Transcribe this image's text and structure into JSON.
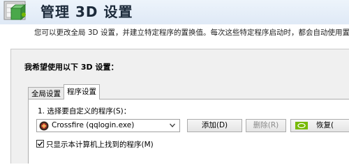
{
  "header": {
    "title": "管理 3D 设置",
    "description": "您可以更改全局 3D 设置，并建立特定程序的置换值。每次这些特定程序启动时，都会自动使用置换"
  },
  "panel": {
    "title": "我希望使用以下 3D 设置："
  },
  "tabs": [
    {
      "label": "全局设置"
    },
    {
      "label": "程序设置"
    }
  ],
  "program_settings": {
    "step1_label": "1. 选择要自定义的程序(S)：",
    "selected_program": "Crossfire (qqlogin.exe)",
    "add_button": "添加(D)",
    "delete_button": "删除(R)",
    "restore_button": "恢复(",
    "show_only_checkbox_label": "只显示本计算机上找到的程序(M)",
    "show_only_checked": true
  },
  "colors": {
    "header_bg": "#e6eef8",
    "nvidia_green": "#76b900"
  },
  "icons": {
    "header": "3d-settings-icon",
    "program": "crossfire-icon",
    "restore": "nvidia-icon",
    "dropdown": "chevron-down-icon",
    "check": "checkmark-icon"
  }
}
